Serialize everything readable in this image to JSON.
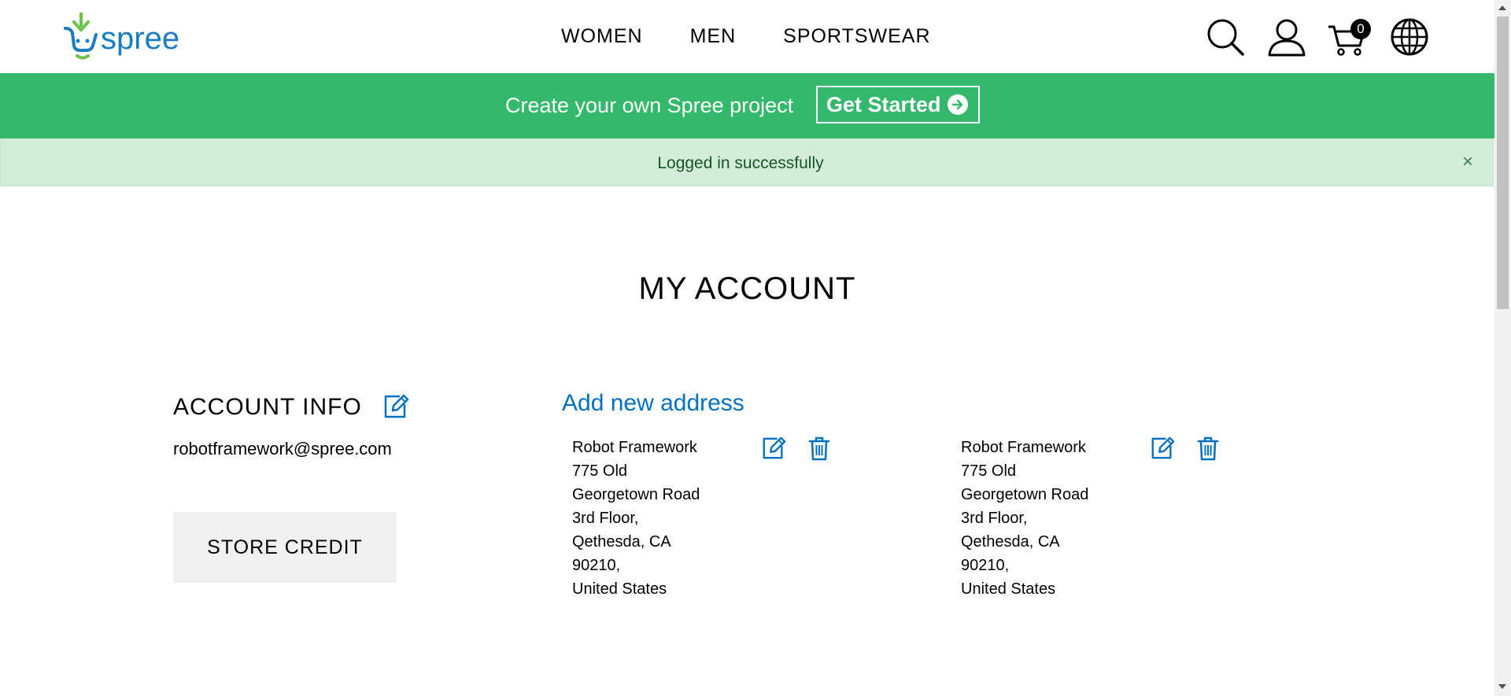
{
  "header": {
    "logo_text": "spree",
    "nav": [
      {
        "label": "WOMEN"
      },
      {
        "label": "MEN"
      },
      {
        "label": "SPORTSWEAR"
      }
    ],
    "icons": [
      "search-icon",
      "account-icon",
      "cart-icon",
      "globe-icon"
    ],
    "cart_count": "0"
  },
  "promo": {
    "text": "Create your own Spree project",
    "button_label": "Get Started",
    "color": "#34b96c"
  },
  "alert": {
    "message": "Logged in successfully",
    "close_label": "×",
    "color": "#d4edda"
  },
  "page": {
    "title": "MY ACCOUNT"
  },
  "account": {
    "title": "ACCOUNT INFO",
    "email": "robotframework@spree.com",
    "store_credit_label": "STORE CREDIT"
  },
  "addresses": {
    "add_label": "Add new address",
    "accent": "#0070c0",
    "items": [
      {
        "lines": [
          "Robot Framework",
          "775 Old",
          "Georgetown Road",
          "3rd Floor,",
          "Qethesda, CA",
          "90210,",
          "United States"
        ]
      },
      {
        "lines": [
          "Robot Framework",
          "775 Old",
          "Georgetown Road",
          "3rd Floor,",
          "Qethesda, CA",
          "90210,",
          "United States"
        ]
      }
    ]
  }
}
